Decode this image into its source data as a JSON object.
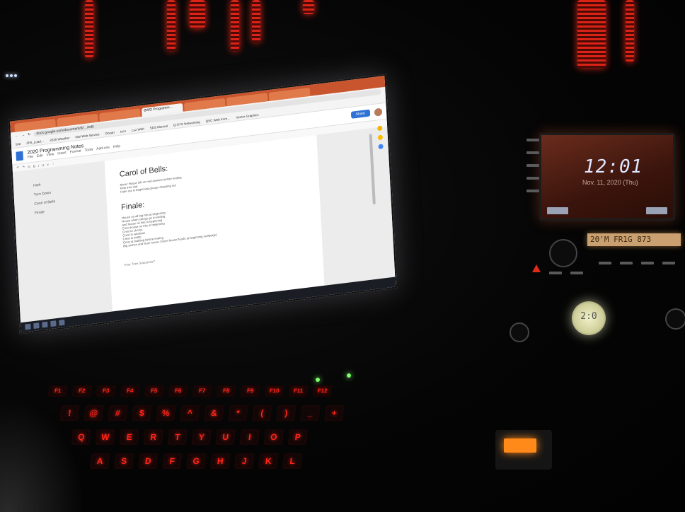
{
  "browser": {
    "tabs": [
      "",
      "",
      "",
      "BWD Programm…",
      "",
      "",
      "",
      ""
    ],
    "url": "docs.google.com/document/d/…/edit",
    "bookmarks": [
      "SNI",
      "ZF6_Load…",
      "2020 Weather",
      "NW Web Service",
      "Ocean",
      "Isco",
      "Luz Web",
      "SDS Manual",
      "Q-SYS Networking",
      "QSC Web from…",
      "Vector Graphics"
    ]
  },
  "document": {
    "title": "2020 Programming Notes",
    "menus": [
      "File",
      "Edit",
      "View",
      "Insert",
      "Format",
      "Tools",
      "Add-ons",
      "Help"
    ],
    "share_label": "Share",
    "outline": [
      "Hark",
      "Turn Down",
      "Carol of Bells",
      "Finale"
    ],
    "section1_heading": "Carol of Bells:",
    "section1_lines": [
      "Music House left on mezzanines before ending",
      "Pink tree star",
      "Fade out in beginning groups dropping out"
    ],
    "section2_heading": "Finale:",
    "section2_lines": [
      "House on all big hits at beginning",
      "House when strings go to ending",
      "and house on hits in beginning",
      "Crest house on hits in beginning",
      "Crest to chorus",
      "Crest to windows",
      "Crest to bottle",
      "Crest at building before ending",
      "Big arches and stars house / trees house floods at beginning (softpage)"
    ],
    "footer_line": "Four Tree Sequence?"
  },
  "clock": {
    "time": "12:01",
    "date": "Nov. 11, 2020 (Thu)"
  },
  "radio": {
    "lcd_text": "20'M FR1G   873",
    "knob_text": "2:0"
  },
  "keyboard": {
    "fn_row": [
      "F1",
      "F2",
      "F3",
      "F4",
      "F5",
      "F6",
      "F7",
      "F8",
      "F9",
      "F10",
      "F11",
      "F12"
    ],
    "num_row": [
      "!",
      "@",
      "#",
      "$",
      "%",
      "^",
      "&",
      "*",
      "(",
      ")",
      "_",
      "+"
    ],
    "letter_row": [
      "Q",
      "W",
      "E",
      "R",
      "T",
      "Y",
      "U",
      "I",
      "O",
      "P"
    ],
    "home_row": [
      "A",
      "S",
      "D",
      "F",
      "G",
      "H",
      "J",
      "K",
      "L"
    ]
  },
  "colors": {
    "key_glow": "#ff2418",
    "docs_blue": "#2f72d6",
    "chrome_orange": "#c8552e",
    "clock_bg": "#6a2c1c",
    "lcd_amber": "#caa070"
  }
}
